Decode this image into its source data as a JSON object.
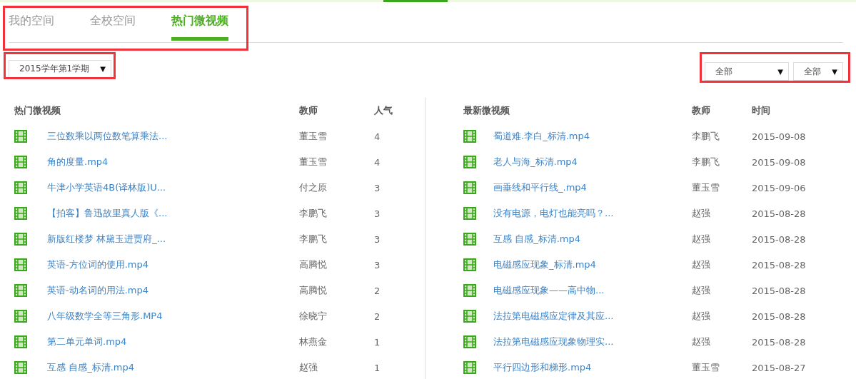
{
  "tabs": [
    {
      "label": "我的空间",
      "selected": false
    },
    {
      "label": "全校空间",
      "selected": false
    },
    {
      "label": "热门微视频",
      "selected": true
    }
  ],
  "term_select": {
    "value": "2015学年第1学期",
    "arrow": "▼"
  },
  "filters": [
    {
      "value": "全部",
      "arrow": "▼"
    },
    {
      "value": "全部",
      "arrow": "▼"
    }
  ],
  "hot_videos": {
    "columns": [
      "热门微视频",
      "教师",
      "人气"
    ],
    "rows": [
      {
        "title": "三位数乘以两位数笔算乘法...",
        "teacher": "董玉雪",
        "views": "4"
      },
      {
        "title": "角的度量.mp4",
        "teacher": "董玉雪",
        "views": "4"
      },
      {
        "title": "牛津小学英语4B(译林版)U...",
        "teacher": "付之原",
        "views": "3"
      },
      {
        "title": "【拍客】鲁迅故里真人版《...",
        "teacher": "李鹏飞",
        "views": "3"
      },
      {
        "title": "新版红楼梦 林黛玉进贾府_...",
        "teacher": "李鹏飞",
        "views": "3"
      },
      {
        "title": "英语-方位词的使用.mp4",
        "teacher": "高腾悦",
        "views": "3"
      },
      {
        "title": "英语-动名词的用法.mp4",
        "teacher": "高腾悦",
        "views": "2"
      },
      {
        "title": "八年级数学全等三角形.MP4",
        "teacher": "徐晓宁",
        "views": "2"
      },
      {
        "title": "第二单元单词.mp4",
        "teacher": "林燕金",
        "views": "1"
      },
      {
        "title": "互感 自感_标清.mp4",
        "teacher": "赵强",
        "views": "1"
      }
    ]
  },
  "latest_videos": {
    "columns": [
      "最新微视频",
      "教师",
      "时间"
    ],
    "rows": [
      {
        "title": "蜀道难.李白_标清.mp4",
        "teacher": "李鹏飞",
        "time": "2015-09-08"
      },
      {
        "title": "老人与海_标清.mp4",
        "teacher": "李鹏飞",
        "time": "2015-09-08"
      },
      {
        "title": "画垂线和平行线_.mp4",
        "teacher": "董玉雪",
        "time": "2015-09-06"
      },
      {
        "title": "没有电源，电灯也能亮吗？...",
        "teacher": "赵强",
        "time": "2015-08-28"
      },
      {
        "title": "互感 自感_标清.mp4",
        "teacher": "赵强",
        "time": "2015-08-28"
      },
      {
        "title": "电磁感应现象_标清.mp4",
        "teacher": "赵强",
        "time": "2015-08-28"
      },
      {
        "title": "电磁感应现象——高中物...",
        "teacher": "赵强",
        "time": "2015-08-28"
      },
      {
        "title": "法拉第电磁感应定律及其应...",
        "teacher": "赵强",
        "time": "2015-08-28"
      },
      {
        "title": "法拉第电磁感应现象物理实...",
        "teacher": "赵强",
        "time": "2015-08-28"
      },
      {
        "title": "平行四边形和梯形.mp4",
        "teacher": "董玉雪",
        "time": "2015-08-27"
      }
    ]
  }
}
